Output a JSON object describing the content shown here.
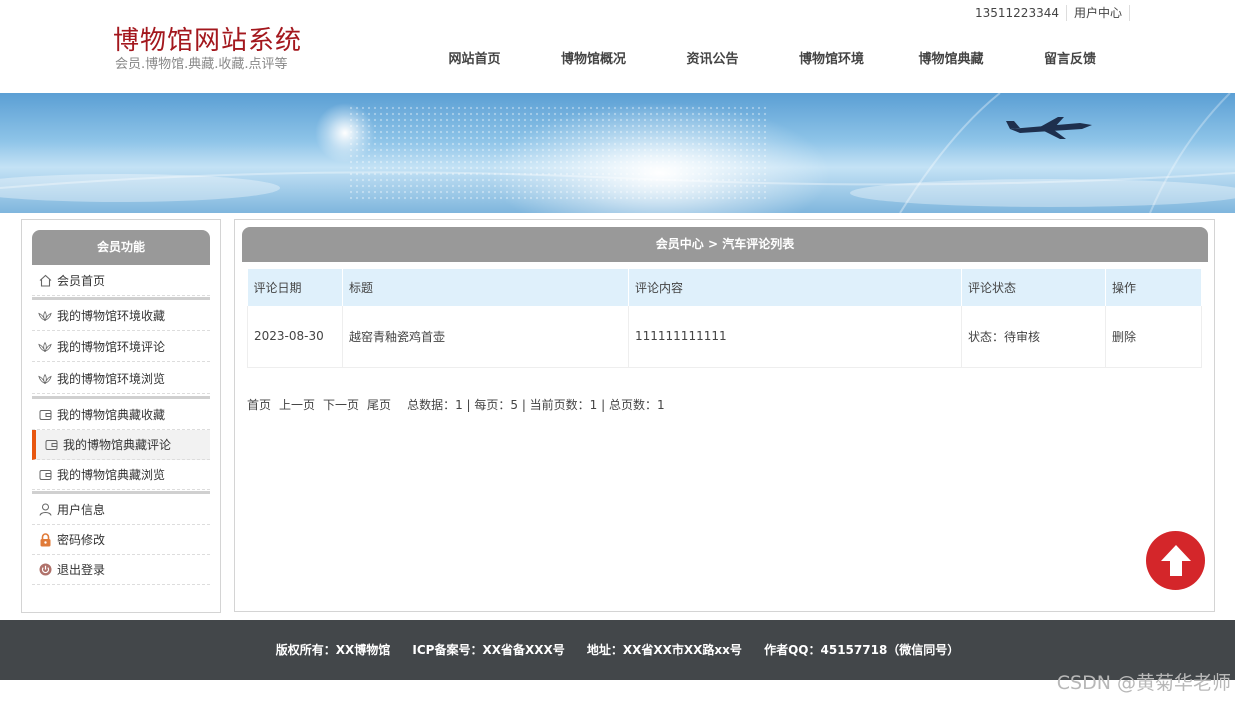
{
  "site": {
    "title": "博物馆网站系统",
    "subtitle": "会员.博物馆.典藏.收藏.点评等"
  },
  "top_links": {
    "phone": "13511223344",
    "user_center": "用户中心"
  },
  "nav": {
    "items": [
      {
        "label": "网站首页"
      },
      {
        "label": "博物馆概况"
      },
      {
        "label": "资讯公告"
      },
      {
        "label": "博物馆环境"
      },
      {
        "label": "博物馆典藏"
      },
      {
        "label": "留言反馈"
      }
    ]
  },
  "sidebar": {
    "title": "会员功能",
    "items": [
      {
        "label": "会员首页",
        "icon": "home-icon"
      },
      {
        "label": "我的博物馆环境收藏",
        "icon": "lotus-icon"
      },
      {
        "label": "我的博物馆环境评论",
        "icon": "lotus-icon"
      },
      {
        "label": "我的博物馆环境浏览",
        "icon": "lotus-icon"
      },
      {
        "label": "我的博物馆典藏收藏",
        "icon": "wallet-icon"
      },
      {
        "label": "我的博物馆典藏评论",
        "icon": "wallet-icon",
        "active": true
      },
      {
        "label": "我的博物馆典藏浏览",
        "icon": "wallet-icon"
      },
      {
        "label": "用户信息",
        "icon": "user-icon"
      },
      {
        "label": "密码修改",
        "icon": "lock-icon"
      },
      {
        "label": "退出登录",
        "icon": "power-icon"
      }
    ]
  },
  "main": {
    "breadcrumb": "会员中心 > 汽车评论列表",
    "table": {
      "headers": [
        "评论日期",
        "标题",
        "评论内容",
        "评论状态",
        "操作"
      ],
      "rows": [
        [
          "2023-08-30",
          "越窑青釉瓷鸡首壶",
          "111111111111",
          "状态：待审核",
          "删除"
        ]
      ]
    },
    "pager": {
      "first": "首页",
      "prev": "上一页",
      "next": "下一页",
      "last": "尾页",
      "stats": "总数据：1 | 每页：5 | 当前页数：1 | 总页数：1"
    }
  },
  "footer": {
    "copyright": "版权所有：XX博物馆",
    "icp": "ICP备案号：XX省备XXX号",
    "address": "地址：XX省XX市XX路xx号",
    "qq": "作者QQ：45157718（微信同号）"
  },
  "watermark": "CSDN @黄菊华老师",
  "colors": {
    "brand": "#a3171d",
    "panel_header": "#999999",
    "table_header": "#dff0fb",
    "active_marker": "#e8560f",
    "to_top": "#d4262a",
    "footer": "#43474a"
  }
}
